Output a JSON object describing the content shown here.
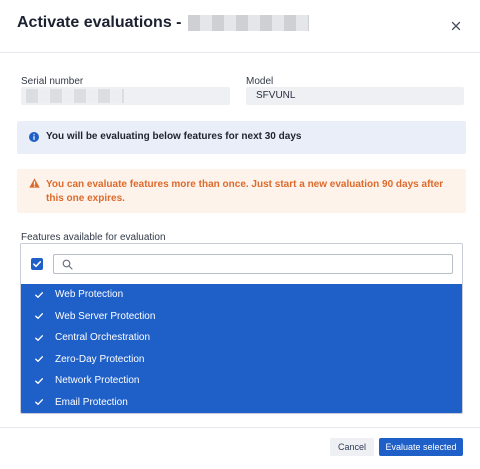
{
  "dialog": {
    "title": "Activate evaluations -",
    "close_icon": "close-icon"
  },
  "serial": {
    "label": "Serial number",
    "value": ""
  },
  "model": {
    "label": "Model",
    "value": "SFVUNL"
  },
  "info_banner": {
    "icon": "info-icon",
    "text": "You will be evaluating below features for next 30 days"
  },
  "warning_banner": {
    "icon": "warning-icon",
    "text": "You can evaluate features more than once. Just start a new evaluation 90 days after this one expires."
  },
  "features": {
    "label": "Features available for evaluation",
    "search_placeholder": "",
    "select_all_checked": true,
    "items": [
      {
        "label": "Web Protection",
        "selected": true
      },
      {
        "label": "Web Server Protection",
        "selected": true
      },
      {
        "label": "Central Orchestration",
        "selected": true
      },
      {
        "label": "Zero-Day Protection",
        "selected": true
      },
      {
        "label": "Network Protection",
        "selected": true
      },
      {
        "label": "Email Protection",
        "selected": true
      }
    ]
  },
  "footer": {
    "cancel_label": "Cancel",
    "evaluate_label": "Evaluate selected"
  },
  "colors": {
    "primary": "#1f5fc8",
    "warning": "#dd6a2d",
    "info_bg": "#e9eef9",
    "warning_bg": "#fdf3ea"
  }
}
